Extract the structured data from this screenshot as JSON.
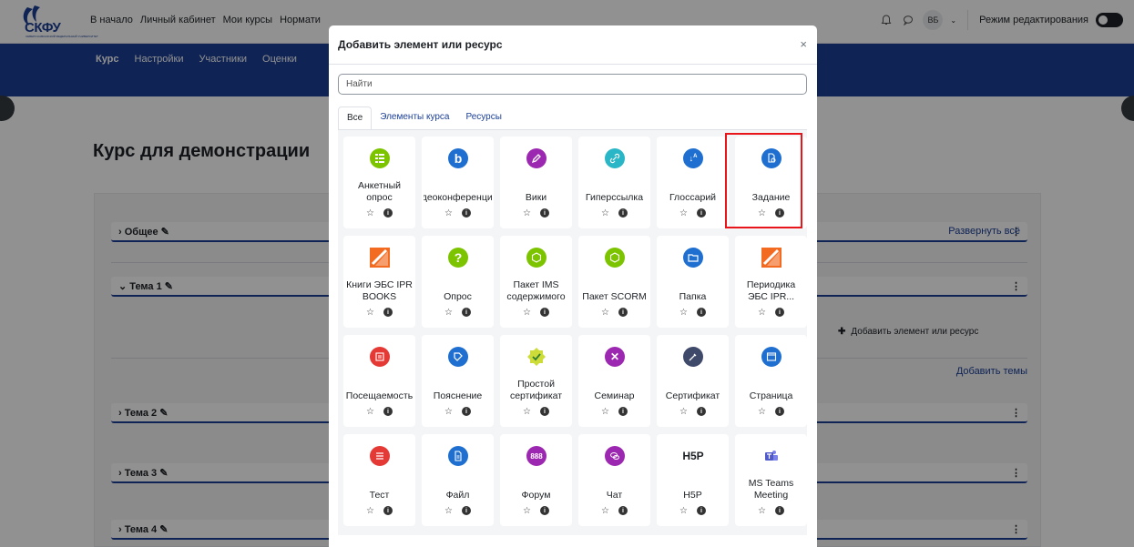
{
  "header": {
    "logo_text": "СКФУ",
    "logo_subtext": "СЕВЕРО-КАВКАЗСКИЙ ФЕДЕРАЛЬНЫЙ УНИВЕРСИТЕТ",
    "nav": [
      "В начало",
      "Личный кабинет",
      "Мои курсы",
      "Нормати"
    ],
    "avatar_initials": "ВБ",
    "edit_mode_label": "Режим редактирования"
  },
  "course_nav": {
    "tabs": [
      "Курс",
      "Настройки",
      "Участники",
      "Оценки"
    ]
  },
  "page": {
    "course_title": "Курс для демонстрации",
    "expand_all": "Развернуть всё",
    "add_resource": "Добавить элемент или ресурс",
    "add_topics": "Добавить темы",
    "sections": [
      "Общее",
      "Тема 1",
      "Тема 2",
      "Тема 3",
      "Тема 4"
    ]
  },
  "modal": {
    "title": "Добавить элемент или ресурс",
    "close_symbol": "×",
    "search_placeholder": "Найти",
    "tabs": [
      "Все",
      "Элементы курса",
      "Ресурсы"
    ],
    "tiles": [
      {
        "name": "Анкетный опрос",
        "icon": "feedback-icon",
        "color": "#7cc400"
      },
      {
        "name": "Видеоконференция...",
        "icon": "bigbluebutton-icon",
        "color": "#1f6fd1"
      },
      {
        "name": "Вики",
        "icon": "wiki-icon",
        "color": "#9c27b0"
      },
      {
        "name": "Гиперссылка",
        "icon": "url-icon",
        "color": "#29b6c6"
      },
      {
        "name": "Глоссарий",
        "icon": "glossary-icon",
        "color": "#1f6fd1"
      },
      {
        "name": "Задание",
        "icon": "assignment-icon",
        "color": "#1f6fd1"
      },
      {
        "name": "Книги ЭБС IPR BOOKS",
        "icon": "iprbooks-icon",
        "color": "#f26b21"
      },
      {
        "name": "Опрос",
        "icon": "choice-icon",
        "color": "#7cc400"
      },
      {
        "name": "Пакет IMS содержимого",
        "icon": "imscp-icon",
        "color": "#7cc400"
      },
      {
        "name": "Пакет SCORM",
        "icon": "scorm-icon",
        "color": "#7cc400"
      },
      {
        "name": "Папка",
        "icon": "folder-icon",
        "color": "#1f6fd1"
      },
      {
        "name": "Периодика ЭБС IPR...",
        "icon": "iprperiodic-icon",
        "color": "#f26b21"
      },
      {
        "name": "Посещаемость",
        "icon": "attendance-icon",
        "color": "#e53935"
      },
      {
        "name": "Пояснение",
        "icon": "label-icon",
        "color": "#1f6fd1"
      },
      {
        "name": "Простой сертификат",
        "icon": "simplecertificate-icon",
        "color": "#8bc34a"
      },
      {
        "name": "Семинар",
        "icon": "workshop-icon",
        "color": "#9c27b0"
      },
      {
        "name": "Сертификат",
        "icon": "certificate-icon",
        "color": "#3f4a6b"
      },
      {
        "name": "Страница",
        "icon": "page-icon",
        "color": "#1f6fd1"
      },
      {
        "name": "Тест",
        "icon": "quiz-icon",
        "color": "#e53935"
      },
      {
        "name": "Файл",
        "icon": "file-icon",
        "color": "#1f6fd1"
      },
      {
        "name": "Форум",
        "icon": "forum-icon",
        "color": "#9c27b0"
      },
      {
        "name": "Чат",
        "icon": "chat-icon",
        "color": "#9c27b0"
      },
      {
        "name": "H5P",
        "icon": "h5p-icon",
        "color": "#1d2125"
      },
      {
        "name": "MS Teams Meeting",
        "icon": "msteams-icon",
        "color": "#5059c9"
      }
    ]
  }
}
